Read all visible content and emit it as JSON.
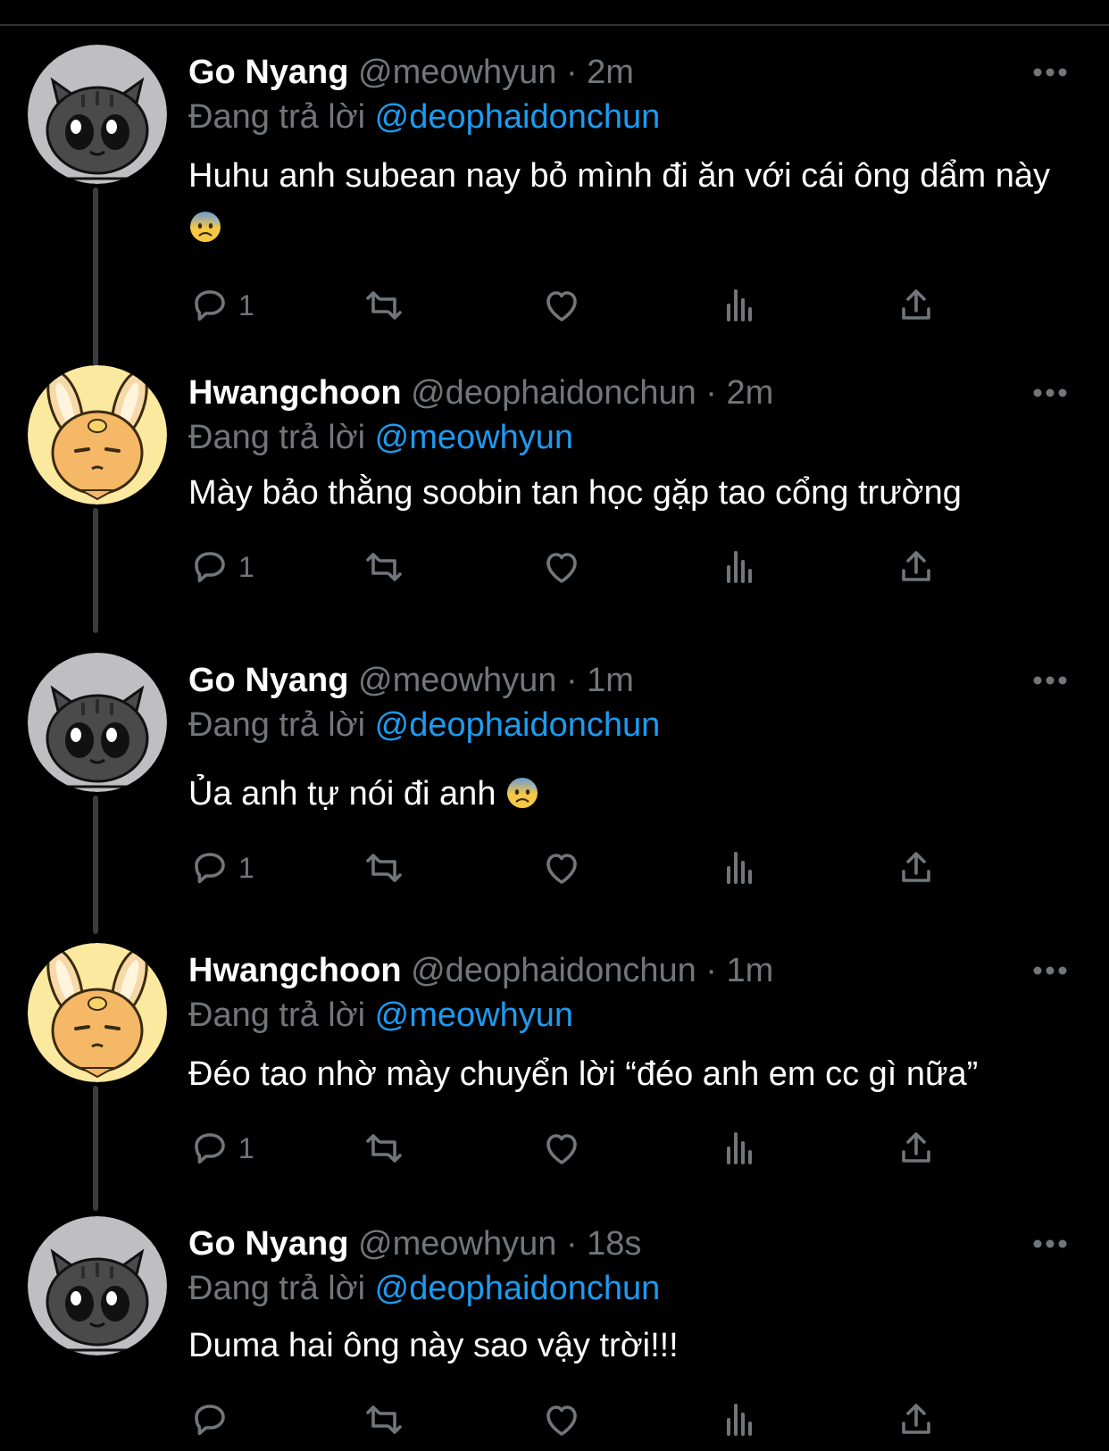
{
  "labels": {
    "replying_to": "Đang trả lời"
  },
  "colors": {
    "background": "#000000",
    "text": "#ffffff",
    "muted": "#71767b",
    "mention": "#1d9bf0",
    "thread_line": "#3a3d40"
  },
  "tweets": [
    {
      "display_name": "Go Nyang",
      "handle": "@meowhyun",
      "dot": "·",
      "time": "2m",
      "reply_to": "@deophaidonchun",
      "text": "Huhu anh subean nay bỏ mình đi ăn với cái ông dẩm này",
      "emoji": "anxious-face-with-sweat",
      "avatar": "gray-cat-avatar",
      "reply_count": "1"
    },
    {
      "display_name": "Hwangchoon",
      "handle": "@deophaidonchun",
      "dot": "·",
      "time": "2m",
      "reply_to": "@meowhyun",
      "text": "Mày bảo thằng soobin tan học gặp tao cổng trường",
      "emoji": "",
      "avatar": "yellow-bunny-avatar",
      "reply_count": "1"
    },
    {
      "display_name": "Go Nyang",
      "handle": "@meowhyun",
      "dot": "·",
      "time": "1m",
      "reply_to": "@deophaidonchun",
      "text": "Ủa anh tự nói đi anh",
      "emoji": "anxious-face-with-sweat",
      "avatar": "gray-cat-avatar",
      "reply_count": "1"
    },
    {
      "display_name": "Hwangchoon",
      "handle": "@deophaidonchun",
      "dot": "·",
      "time": "1m",
      "reply_to": "@meowhyun",
      "text": "Đéo tao nhờ mày chuyển lời “đéo anh em cc gì nữa”",
      "emoji": "",
      "avatar": "yellow-bunny-avatar",
      "reply_count": "1"
    },
    {
      "display_name": "Go Nyang",
      "handle": "@meowhyun",
      "dot": "·",
      "time": "18s",
      "reply_to": "@deophaidonchun",
      "text": "Duma hai ông này sao vậy trời!!!",
      "emoji": "",
      "avatar": "gray-cat-avatar",
      "reply_count": ""
    }
  ]
}
